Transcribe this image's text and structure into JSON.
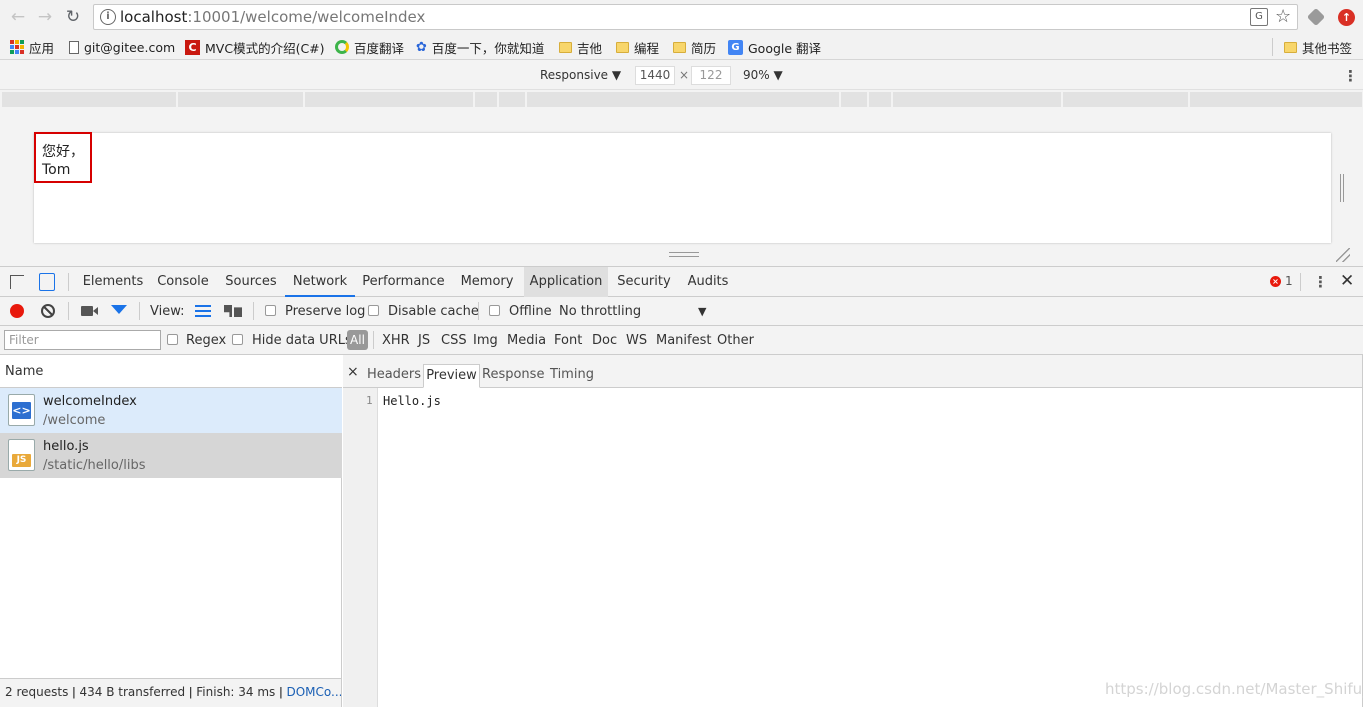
{
  "browser": {
    "url_host": "localhost",
    "url_rest": ":10001/welcome/welcomeIndex"
  },
  "bookmarks": [
    {
      "label": "应用",
      "icon": "apps-icon"
    },
    {
      "label": "git@gitee.com",
      "icon": "page-icon"
    },
    {
      "label": "MVC模式的介绍(C#)",
      "icon": "csdn-icon"
    },
    {
      "label": "百度翻译",
      "icon": "baidu-translate-icon"
    },
    {
      "label": "百度一下，你就知道",
      "icon": "baidu-paw-icon"
    },
    {
      "label": "吉他",
      "icon": "folder-icon"
    },
    {
      "label": "编程",
      "icon": "folder-icon"
    },
    {
      "label": "简历",
      "icon": "folder-icon"
    },
    {
      "label": "Google 翻译",
      "icon": "google-translate-icon"
    }
  ],
  "bookmarks_other": "其他书签",
  "device": {
    "mode": "Responsive",
    "width": "1440",
    "times": "×",
    "height": "122",
    "zoom": "90%"
  },
  "page": {
    "greeting_line1": "您好，",
    "greeting_line2": "Tom"
  },
  "devtools": {
    "tabs": [
      "Elements",
      "Console",
      "Sources",
      "Network",
      "Performance",
      "Memory",
      "Application",
      "Security",
      "Audits"
    ],
    "error_count": "1"
  },
  "network": {
    "view_label": "View:",
    "preserve_log": "Preserve log",
    "disable_cache": "Disable cache",
    "offline": "Offline",
    "throttling": "No throttling",
    "filter_placeholder": "Filter",
    "regex": "Regex",
    "hide_data_urls": "Hide data URLs",
    "types": [
      "All",
      "XHR",
      "JS",
      "CSS",
      "Img",
      "Media",
      "Font",
      "Doc",
      "WS",
      "Manifest",
      "Other"
    ]
  },
  "requests": {
    "header": "Name",
    "rows": [
      {
        "name": "welcomeIndex",
        "path": "/welcome",
        "type": "doc"
      },
      {
        "name": "hello.js",
        "path": "/static/hello/libs",
        "type": "js"
      }
    ]
  },
  "status_bar": {
    "text": "2 requests ǀ 434 B transferred ǀ Finish: 34 ms ǀ ",
    "link": "DOMCo..."
  },
  "detail": {
    "close": "×",
    "tabs": [
      "Headers",
      "Preview",
      "Response",
      "Timing"
    ],
    "line_number": "1",
    "content": "Hello.js"
  },
  "watermark": "https://blog.csdn.net/Master_Shifu_",
  "colors": {
    "accent": "#1a73e8",
    "record": "#e8190c",
    "highlight_border": "#d60000",
    "selected_row": "#dcebfb",
    "hover_row": "#d6d6d6"
  }
}
